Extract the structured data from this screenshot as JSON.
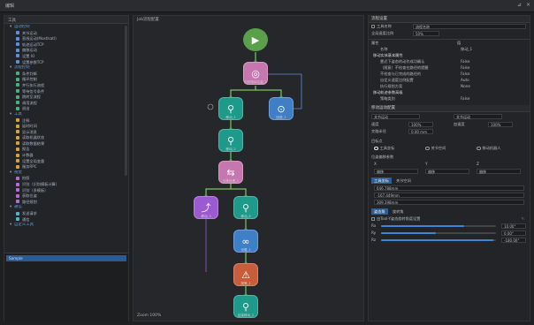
{
  "window": {
    "title": "编辑",
    "pin": "⊿",
    "close": "×"
  },
  "left": {
    "header": "工具",
    "tree": [
      {
        "type": "cat",
        "label": "运动控制"
      },
      {
        "type": "item",
        "label": "关节运动",
        "color": "#5b8fd6"
      },
      {
        "type": "item",
        "label": "直线运动(Mostlsatl)",
        "color": "#5b8fd6"
      },
      {
        "type": "item",
        "label": "轨迹运动TCP",
        "color": "#5b8fd6"
      },
      {
        "type": "item",
        "label": "偏移运动",
        "color": "#5b8fd6"
      },
      {
        "type": "item",
        "label": "设置 IO",
        "color": "#5b8fd6"
      },
      {
        "type": "item",
        "label": "设置参数TCP",
        "color": "#5b8fd6"
      },
      {
        "type": "cat",
        "label": "流程控制"
      },
      {
        "type": "item",
        "label": "条件判断",
        "color": "#4caf7d"
      },
      {
        "type": "item",
        "label": "循环控制",
        "color": "#4caf7d"
      },
      {
        "type": "item",
        "label": "并行执行流程",
        "color": "#4caf7d"
      },
      {
        "type": "item",
        "label": "等待信号条件",
        "color": "#4caf7d"
      },
      {
        "type": "item",
        "label": "跳转至流程",
        "color": "#4caf7d"
      },
      {
        "type": "item",
        "label": "调用流程",
        "color": "#4caf7d"
      },
      {
        "type": "item",
        "label": "退出",
        "color": "#4caf7d"
      },
      {
        "type": "cat",
        "label": "工具"
      },
      {
        "type": "item",
        "label": "注释",
        "color": "#d6a33b"
      },
      {
        "type": "item",
        "label": "延时时间",
        "color": "#d6a33b"
      },
      {
        "type": "item",
        "label": "显示消息",
        "color": "#d6a33b"
      },
      {
        "type": "item",
        "label": "读取机器状态",
        "color": "#d6a33b"
      },
      {
        "type": "item",
        "label": "读取数据结果",
        "color": "#d6a33b"
      },
      {
        "type": "item",
        "label": "报告",
        "color": "#d6a33b"
      },
      {
        "type": "item",
        "label": "计数器",
        "color": "#d6a33b"
      },
      {
        "type": "item",
        "label": "设置全局变量",
        "color": "#d6a33b"
      },
      {
        "type": "item",
        "label": "服务RPC",
        "color": "#d6a33b"
      },
      {
        "type": "cat",
        "label": "视觉"
      },
      {
        "type": "item",
        "label": "拍照",
        "color": "#b46dd6"
      },
      {
        "type": "item",
        "label": "识别（识别模板计算）",
        "color": "#b46dd6"
      },
      {
        "type": "item",
        "label": "识别（多模板）",
        "color": "#b46dd6"
      },
      {
        "type": "item",
        "label": "获取位姿",
        "color": "#b46dd6"
      },
      {
        "type": "item",
        "label": "路径规划",
        "color": "#b46dd6"
      },
      {
        "type": "cat",
        "label": "通信"
      },
      {
        "type": "item",
        "label": "发送请求",
        "color": "#4db6c4"
      },
      {
        "type": "item",
        "label": "通信",
        "color": "#4db6c4"
      },
      {
        "type": "cat",
        "label": "自定义工具"
      }
    ],
    "bottom_item": "Sample"
  },
  "canvas": {
    "header": "Job流程配置",
    "zoom": "Zoom 100%",
    "nodes": [
      {
        "id": "start",
        "label": "",
        "color": "#5aa04a",
        "shape": "circle",
        "glyph": "▶"
      },
      {
        "id": "n1",
        "label": "识别物体位姿_1",
        "color": "#c777b0",
        "glyph": "◎"
      },
      {
        "id": "n2",
        "label": "移动_1",
        "color": "#1e9a8a",
        "glyph": "⚲"
      },
      {
        "id": "n3",
        "label": "回退_1",
        "color": "#3f7fc8",
        "glyph": "⊙"
      },
      {
        "id": "n4",
        "label": "移动_2",
        "color": "#1e9a8a",
        "glyph": "⚲"
      },
      {
        "id": "n5",
        "label": "分拣处理_1",
        "color": "#c777b0",
        "glyph": "⇆"
      },
      {
        "id": "n6",
        "label": "移动_3",
        "color": "#9c5ad0",
        "glyph": "⤴"
      },
      {
        "id": "n7",
        "label": "移动_4",
        "color": "#1e9a8a",
        "glyph": "⚲"
      },
      {
        "id": "n8",
        "label": "设置_1",
        "color": "#3f7fc8",
        "glyph": "∞"
      },
      {
        "id": "n9",
        "label": "报警_1",
        "color": "#c75d3a",
        "glyph": "⚠"
      },
      {
        "id": "n10",
        "label": "结束移动_1",
        "color": "#1e9a8a",
        "glyph": "⚲"
      }
    ]
  },
  "right": {
    "section1_title": "流程设置",
    "tool_name_label": "工具名称",
    "tool_name_value": "流程名称",
    "speed_label": "全局速度比例",
    "speed_value": "50%",
    "props_header_left": "属性",
    "props_header_right": "值",
    "props": [
      {
        "k": "名称",
        "v": "移动_1"
      },
      {
        "k": "移动实体基本属性",
        "v": "",
        "group": true
      },
      {
        "k": "靠近下姿态的动作成功确认",
        "v": "False"
      },
      {
        "k": "（随意）不检查在路径的提醒",
        "v": "False"
      },
      {
        "k": "不检查与已完成的路径的",
        "v": "False"
      },
      {
        "k": "自定义速度比例配置",
        "v": "Auto"
      },
      {
        "k": "执行规划方案",
        "v": "None"
      },
      {
        "k": "移动轨迹参数高级",
        "v": "",
        "group": true
      },
      {
        "k": "策略类别",
        "v": "False"
      }
    ],
    "section2_title": "移动运动配置",
    "move_type_label": "移动类型",
    "move_type_value": "关节运动",
    "mode_label": "运动方式",
    "mode_value": "关节运动",
    "speed2_label": "速度",
    "speed2_value": "100%",
    "accel_label": "加速度",
    "accel_value": "100%",
    "blend_label": "交融半径",
    "blend_value": "0.00 mm",
    "target_title": "目标点",
    "radio_labels": [
      "工具坐标",
      "关节空间",
      "移动机器人"
    ],
    "radio_selected": 0,
    "pose_title": "位姿偏移参数",
    "pose_cols": [
      "X",
      "Y",
      "Z"
    ],
    "pose_vals": [
      "偏移",
      "偏移",
      "偏移"
    ],
    "tabs": [
      "工具坐标",
      "关节空间"
    ],
    "coord_values": [
      "646.788mm",
      "-167.449mm",
      "309.398mm"
    ],
    "bottom_tabs": [
      "姿态角",
      "旋转角"
    ],
    "rotation_title": "由Tool-Y姿态旋转角度设置",
    "sliders": [
      {
        "label": "Rx",
        "value": "10.00°",
        "fill": 0.72
      },
      {
        "label": "Ry",
        "value": "0.00°",
        "fill": 0.48
      },
      {
        "label": "Rz",
        "value": "-180.00°",
        "fill": 0.98
      }
    ]
  }
}
